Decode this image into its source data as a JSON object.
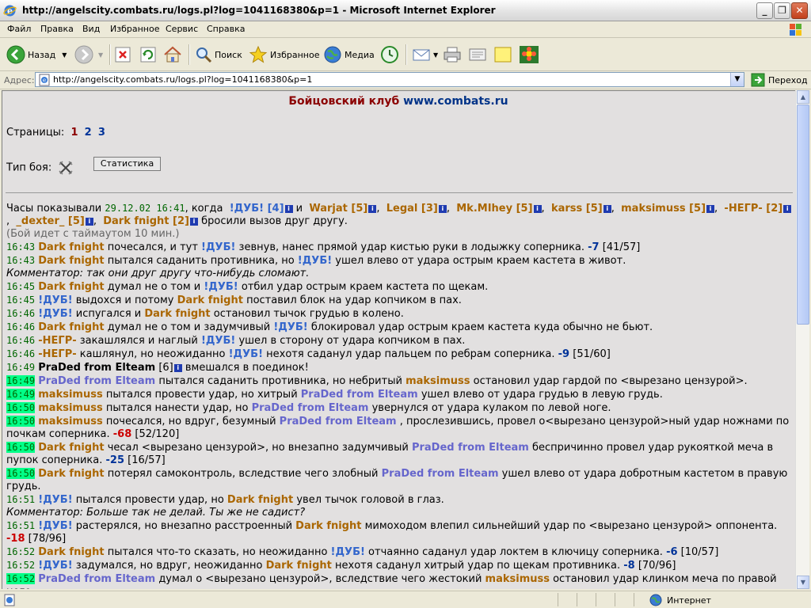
{
  "window": {
    "title": "http://angelscity.combats.ru/logs.pl?log=1041168380&p=1 - Microsoft Internet Explorer",
    "minimize": "_",
    "maximize": "❐",
    "close": "✕"
  },
  "menu": [
    "Файл",
    "Правка",
    "Вид",
    "Избранное",
    "Сервис",
    "Справка"
  ],
  "toolbar": {
    "back": "Назад",
    "search": "Поиск",
    "favorites": "Избранное",
    "media": "Медиа"
  },
  "address": {
    "label": "Адрес:",
    "url": "http://angelscity.combats.ru/logs.pl?log=1041168380&p=1",
    "go": "Переход"
  },
  "status": {
    "zone": "Интернет"
  },
  "page": {
    "header_title": "Бойцовский клуб",
    "header_site": "www.combats.ru",
    "pages_label": "Страницы:",
    "pages": [
      "1",
      "2",
      "3"
    ],
    "battle_type_label": "Тип боя:",
    "stats_button": "Статистика",
    "intro": {
      "a": "Часы показывали",
      "time": "29.12.02 16:41",
      "b": ", когда",
      "team1": "!ДУБ! [4]",
      "and": "и",
      "team2": [
        "Warjat [5]",
        "Legal [3]",
        "Mk.MIhey [5]",
        "karss [5]",
        "maksimuss [5]",
        "-НЕГР- [2]",
        "_dexter_ [5]",
        "Dark fnight [2]"
      ],
      "challenge": "бросили вызов друг другу.",
      "timeout": "(Бой идет с таймаутом 10 мин.)"
    },
    "log": [
      {
        "time": "16:43",
        "a": "Dark fnight",
        "t1": " почесался, и тут ",
        "b": "!ДУБ!",
        "t2": " зевнув, нанес прямой удар кистью руки в лодыжку соперника. ",
        "dmg": "-7",
        "hp": " [41/57]"
      },
      {
        "time": "16:43",
        "a": "Dark fnight",
        "t1": " пытался саданить противника, но ",
        "b": "!ДУБ!",
        "t2": " ушел влево от удара острым краем кастета в живот."
      },
      {
        "comment": "Комментатор: так они друг другу что-нибудь сломают."
      },
      {
        "time": "16:45",
        "a": "Dark fnight",
        "t1": " думал не о том и ",
        "b": "!ДУБ!",
        "t2": " отбил удар острым краем кастета по щекам."
      },
      {
        "time": "16:45",
        "b": "!ДУБ!",
        "t1": " выдохся и потому ",
        "a": "Dark fnight",
        "t2": " поставил блок на удар копчиком в пах."
      },
      {
        "time": "16:46",
        "b": "!ДУБ!",
        "t1": " испугался и ",
        "a": "Dark fnight",
        "t2": " остановил тычок грудью в колено."
      },
      {
        "time": "16:46",
        "a": "Dark fnight",
        "t1": " думал не о том и задумчивый ",
        "b": "!ДУБ!",
        "t2": " блокировал удар острым краем кастета куда обычно не бьют."
      },
      {
        "time": "16:46",
        "a": "-НЕГР-",
        "t1": " закашлялся и наглый ",
        "b": "!ДУБ!",
        "t2": " ушел в сторону от удара копчиком в пах."
      },
      {
        "time": "16:46",
        "a": "-НЕГР-",
        "t1": " кашлянул, но неожиданно ",
        "b": "!ДУБ!",
        "t2": " нехотя саданул удар пальцем по ребрам соперника. ",
        "dmg": "-9",
        "hp": " [51/60]"
      },
      {
        "time": "16:49",
        "join": "PraDed from Elteam",
        "lvl": "[6]",
        "t1": " вмешался в поединок!"
      },
      {
        "time": "16:49",
        "hl": true,
        "p": "PraDed from Elteam",
        "t1": " пытался саданить противника, но небритый ",
        "a": "maksimuss",
        "t2": " остановил удар гардой по <вырезано цензурой>."
      },
      {
        "time": "16:49",
        "hl": true,
        "a": "maksimuss",
        "t1": " пытался провести удар, но хитрый ",
        "p": "PraDed from Elteam",
        "t2": " ушел влево от удара грудью в левую грудь."
      },
      {
        "time": "16:50",
        "hl": true,
        "a": "maksimuss",
        "t1": " пытался нанести удар, но ",
        "p": "PraDed from Elteam",
        "t2": " увернулся от удара кулаком по левой ноге."
      },
      {
        "time": "16:50",
        "hl": true,
        "a": "maksimuss",
        "t1": " почесался, но вдруг, безумный ",
        "p": "PraDed from Elteam",
        "t2": " , прослезившись, провел о<вырезано цензурой>ный удар ножнами по почкам соперника. ",
        "rdmg": "-68",
        "hp": " [52/120]"
      },
      {
        "time": "16:50",
        "hl": true,
        "a": "Dark fnight",
        "t1": " чесал <вырезано цензурой>, но внезапно задумчивый ",
        "p": "PraDed from Elteam",
        "t2": " беспричинно провел удар рукояткой меча в пупок соперника. ",
        "dmg": "-25",
        "hp": " [16/57]"
      },
      {
        "time": "16:50",
        "hl": true,
        "a": "Dark fnight",
        "t1": " потерял самоконтроль, вследствие чего злобный ",
        "p": "PraDed from Elteam",
        "t2": " ушел влево от удара добротным кастетом в правую грудь."
      },
      {
        "time": "16:51",
        "b": "!ДУБ!",
        "t1": " пытался провести удар, но ",
        "a": "Dark fnight",
        "t2": " увел тычок головой в глаз."
      },
      {
        "comment": "Комментатор: Больше так не делай. Ты же не садист?"
      },
      {
        "time": "16:51",
        "b": "!ДУБ!",
        "t1": " растерялся, но внезапно расстроенный ",
        "a": "Dark fnight",
        "t2": " мимоходом влепил сильнейший удар по <вырезано цензурой> оппонента. ",
        "rdmg": "-18",
        "hp": " [78/96]"
      },
      {
        "time": "16:52",
        "a": "Dark fnight",
        "t1": " пытался что-то сказать, но неожиданно ",
        "b": "!ДУБ!",
        "t2": " отчаянно саданул удар локтем в ключицу соперника. ",
        "dmg": "-6",
        "hp": " [10/57]"
      },
      {
        "time": "16:52",
        "b": "!ДУБ!",
        "t1": " задумался, но вдруг, неожиданно ",
        "a": "Dark fnight",
        "t2": " нехотя саданул хитрый удар по щекам противника. ",
        "dmg": "-8",
        "hp": " [70/96]"
      },
      {
        "time": "16:52",
        "hl": true,
        "p": "PraDed from Elteam",
        "t1": " думал о <вырезано цензурой>, вследствие чего жестокий ",
        "a": "maksimuss",
        "t2": " остановил удар клинком меча по правой ноге."
      }
    ]
  },
  "colors": {
    "time": "#006600",
    "highlight": "#00FF88",
    "team_blue": "#3366cc",
    "team_orange": "#aa6600",
    "praded": "#6666cc",
    "damage": "#003399",
    "damage_red": "#cc0000"
  }
}
